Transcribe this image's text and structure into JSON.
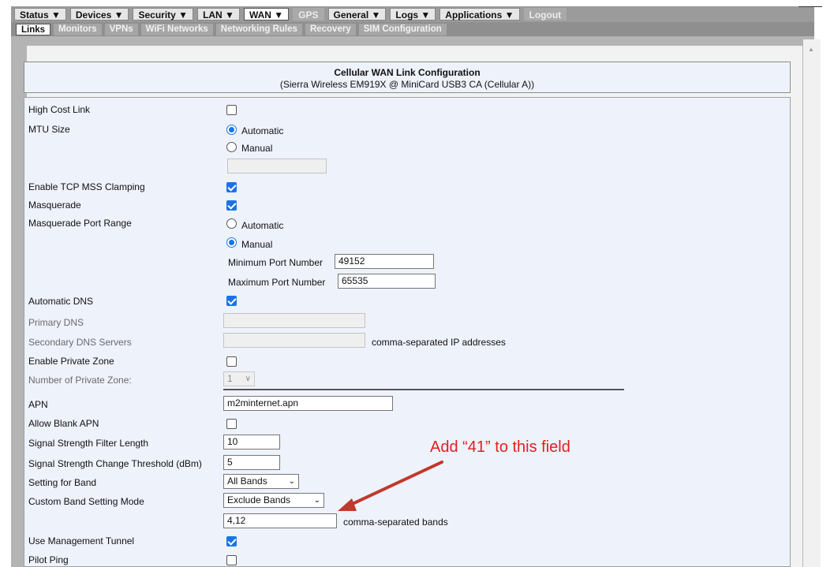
{
  "nav": {
    "menus": [
      "Status ▼",
      "Devices ▼",
      "Security ▼",
      "LAN ▼",
      "WAN ▼",
      "GPS",
      "General ▼",
      "Logs ▼",
      "Applications ▼",
      "Logout"
    ],
    "submenus": [
      "Links",
      "Monitors",
      "VPNs",
      "WiFi Networks",
      "Networking Rules",
      "Recovery",
      "SIM Configuration"
    ]
  },
  "header": {
    "title": "Cellular WAN Link Configuration",
    "subtitle": "(Sierra Wireless EM919X @ MiniCard USB3 CA (Cellular A))"
  },
  "form": {
    "high_cost_link": "High Cost Link",
    "mtu_size": "MTU Size",
    "mtu_automatic": "Automatic",
    "mtu_manual": "Manual",
    "tcp_mss": "Enable TCP MSS Clamping",
    "masquerade": "Masquerade",
    "masq_port_range": "Masquerade Port Range",
    "masq_automatic": "Automatic",
    "masq_manual": "Manual",
    "min_port_label": "Minimum Port Number",
    "min_port_value": "49152",
    "max_port_label": "Maximum Port Number",
    "max_port_value": "65535",
    "automatic_dns": "Automatic DNS",
    "primary_dns": "Primary DNS",
    "secondary_dns": "Secondary DNS Servers",
    "secondary_dns_hint": "comma-separated IP addresses",
    "private_zone": "Enable Private Zone",
    "num_private_zone": "Number of Private Zone:",
    "num_private_zone_value": "1",
    "apn": "APN",
    "apn_value": "m2minternet.apn",
    "allow_blank_apn": "Allow Blank APN",
    "signal_filter": "Signal Strength Filter Length",
    "signal_filter_value": "10",
    "signal_threshold": "Signal Strength Change Threshold (dBm)",
    "signal_threshold_value": "5",
    "setting_band": "Setting for Band",
    "setting_band_value": "All Bands",
    "custom_band_mode": "Custom Band Setting Mode",
    "custom_band_mode_value": "Exclude Bands",
    "bands_value": "4,12",
    "bands_hint": "comma-separated bands",
    "mgmt_tunnel": "Use Management Tunnel",
    "pilot_ping": "Pilot Ping"
  },
  "annotation": {
    "text": "Add “41” to this field",
    "color": "#e02020"
  }
}
